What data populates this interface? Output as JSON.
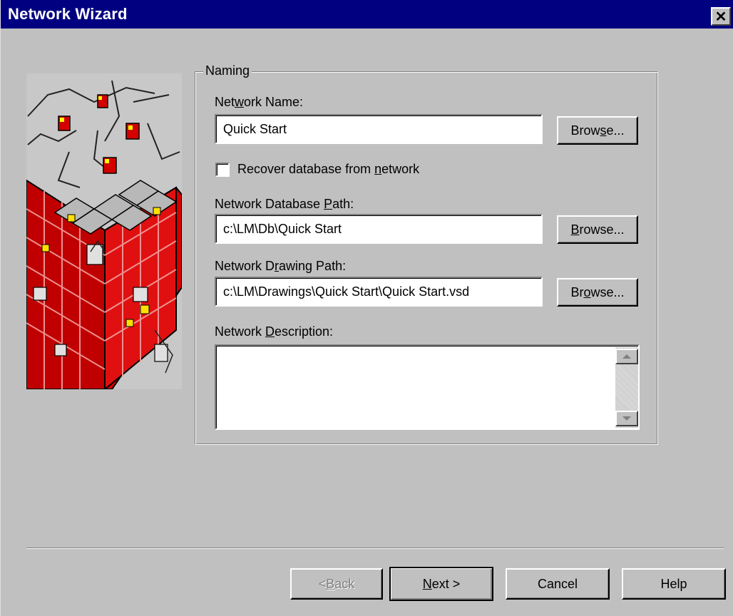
{
  "window": {
    "title": "Network Wizard",
    "close_glyph": "✕"
  },
  "naming": {
    "legend": "Naming",
    "network_name": {
      "label_pre": "Net",
      "label_key": "w",
      "label_post": "ork Name:",
      "value": "Quick Start"
    },
    "recover": {
      "label_pre": "Recover database from ",
      "label_key": "n",
      "label_post": "etwork",
      "checked": false
    },
    "db_path": {
      "label_pre": "Network Database ",
      "label_key": "P",
      "label_post": "ath:",
      "value": "c:\\LM\\Db\\Quick Start"
    },
    "drawing_path": {
      "label_pre": "Network D",
      "label_key": "r",
      "label_post": "awing Path:",
      "value": "c:\\LM\\Drawings\\Quick Start\\Quick Start.vsd"
    },
    "description": {
      "label_pre": "Network ",
      "label_key": "D",
      "label_post": "escription:",
      "value": ""
    },
    "browse1": {
      "pre": "Brow",
      "key": "s",
      "post": "e..."
    },
    "browse2": {
      "pre": "",
      "key": "B",
      "post": "rowse..."
    },
    "browse3": {
      "pre": "Br",
      "key": "o",
      "post": "wse..."
    }
  },
  "footer": {
    "back": {
      "pre": "< ",
      "key": "B",
      "post": "ack",
      "enabled": false
    },
    "next": {
      "pre": "",
      "key": "N",
      "post": "ext >"
    },
    "cancel": "Cancel",
    "help": "Help"
  },
  "icons": {
    "close": "close-icon",
    "scroll_up": "arrow-up-icon",
    "scroll_down": "arrow-down-icon",
    "illustration": "network-wizard-illustration"
  },
  "colors": {
    "titlebar": "#000080",
    "face": "#c0c0c0",
    "accent_red": "#d40000"
  }
}
